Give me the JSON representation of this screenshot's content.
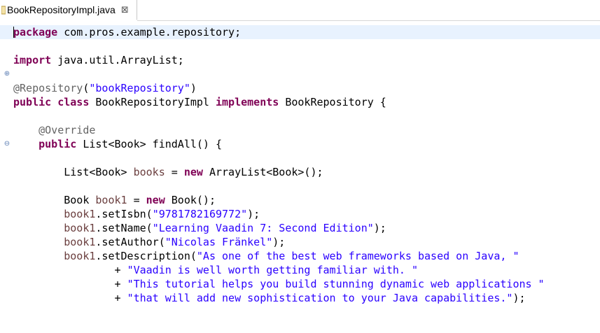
{
  "tab": {
    "title": "BookRepositoryImpl.java",
    "close_symbol": "⊠"
  },
  "gutter": {
    "import_fold": "⊕",
    "method_fold": "⊖"
  },
  "code": {
    "l1": {
      "kw": "package",
      "rest": " com.pros.example.repository;"
    },
    "l2": {
      "kw": "import",
      "rest": " java.util.ArrayList;"
    },
    "l3": {
      "ann": "@Repository",
      "p1": "(",
      "str": "\"bookRepository\"",
      "p2": ")"
    },
    "l4": {
      "kw1": "public class",
      "mid": " BookRepositoryImpl ",
      "kw2": "implements",
      "rest": " BookRepository {"
    },
    "l5": {
      "indent": "    ",
      "ann": "@Override"
    },
    "l6": {
      "indent": "    ",
      "kw": "public",
      "rest": " List<Book> findAll() {"
    },
    "l7": {
      "indent": "        ",
      "pre": "List<Book> ",
      "var": "books",
      "eq": " = ",
      "kw": "new",
      "rest": " ArrayList<Book>();"
    },
    "l8": {
      "indent": "        ",
      "pre": "Book ",
      "var": "book1",
      "eq": " = ",
      "kw": "new",
      "rest": " Book();"
    },
    "l9": {
      "indent": "        ",
      "var": "book1",
      "call": ".setIsbn(",
      "str": "\"9781782169772\"",
      "end": ");"
    },
    "l10": {
      "indent": "        ",
      "var": "book1",
      "call": ".setName(",
      "str": "\"Learning Vaadin 7: Second Edition\"",
      "end": ");"
    },
    "l11": {
      "indent": "        ",
      "var": "book1",
      "call": ".setAuthor(",
      "str": "\"Nicolas Fränkel\"",
      "end": ");"
    },
    "l12": {
      "indent": "        ",
      "var": "book1",
      "call": ".setDescription(",
      "str": "\"As one of the best web frameworks based on Java, \""
    },
    "l13": {
      "indent": "                ",
      "plus": "+ ",
      "str": "\"Vaadin is well worth getting familiar with. \""
    },
    "l14": {
      "indent": "                ",
      "plus": "+ ",
      "str": "\"This tutorial helps you build stunning dynamic web applications \""
    },
    "l15": {
      "indent": "                ",
      "plus": "+ ",
      "str": "\"that will add new sophistication to your Java capabilities.\"",
      "end": ");"
    }
  },
  "colors": {
    "keyword": "#7f0055",
    "string": "#2a00ff",
    "annotation": "#646464",
    "local_variable": "#6a3e3e",
    "current_line": "#e8f2fe"
  }
}
